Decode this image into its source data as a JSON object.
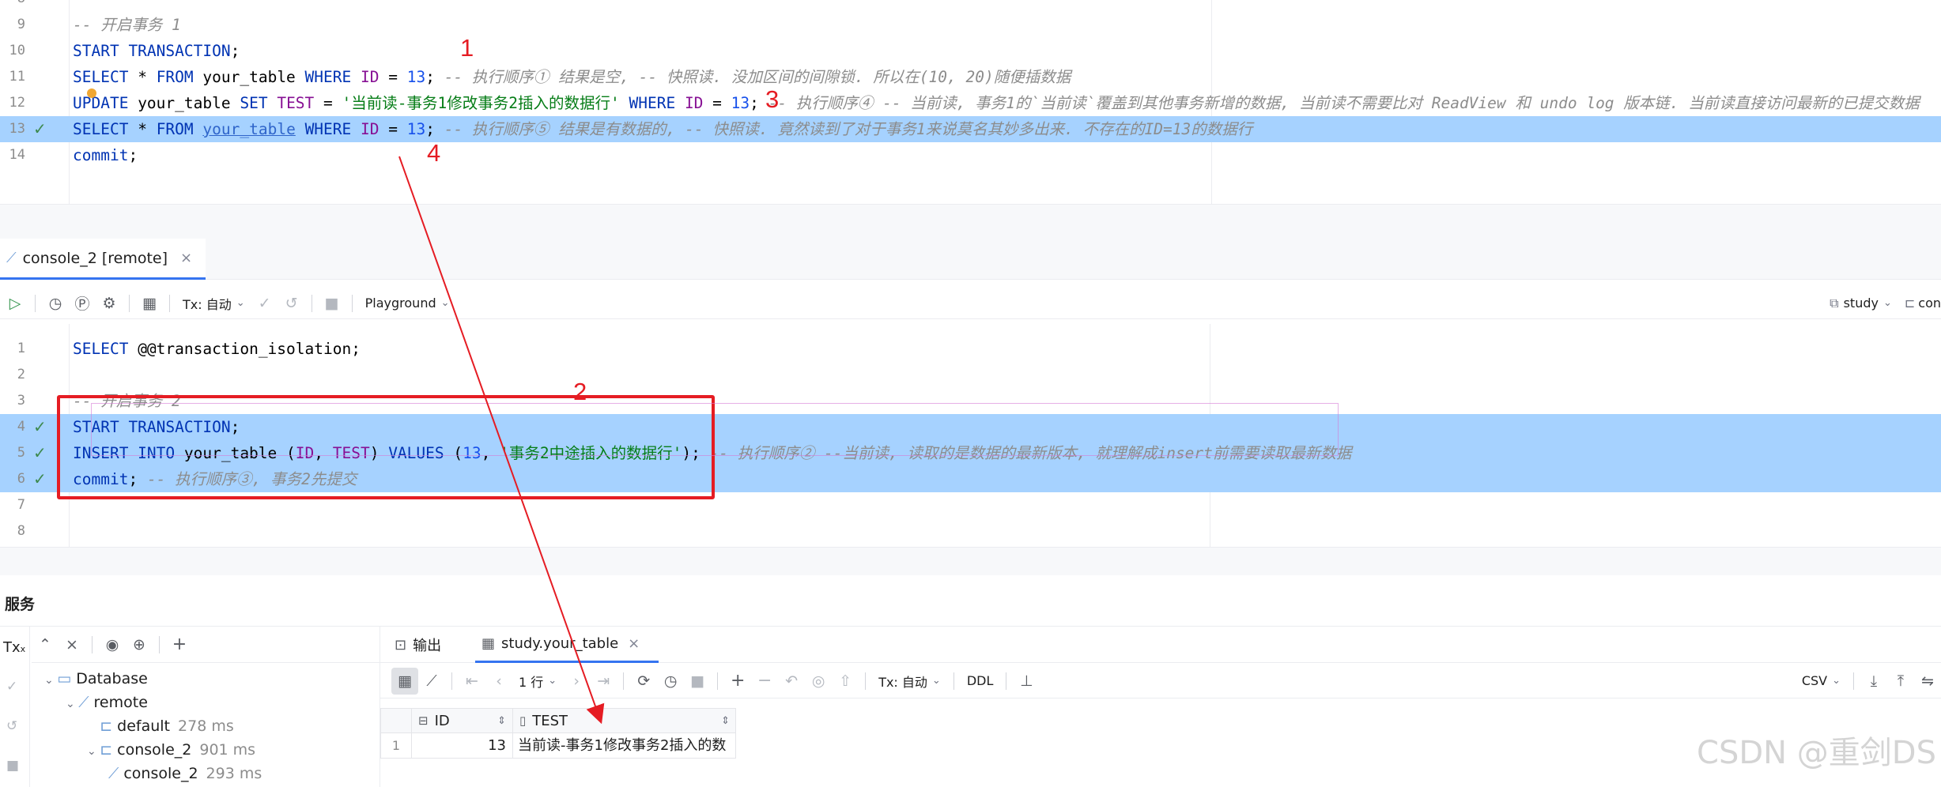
{
  "editor_top": {
    "lines": [
      {
        "n": "8",
        "tokens": []
      },
      {
        "n": "9",
        "tokens": [
          {
            "c": "cm",
            "t": "-- 开启事务 1"
          }
        ]
      },
      {
        "n": "10",
        "tokens": [
          {
            "c": "kw",
            "t": "START TRANSACTION"
          },
          {
            "c": "pl",
            "t": ";"
          }
        ]
      },
      {
        "n": "11",
        "tokens": [
          {
            "c": "kw",
            "t": "SELECT"
          },
          {
            "c": "pl",
            "t": " * "
          },
          {
            "c": "kw",
            "t": "FROM"
          },
          {
            "c": "pl",
            "t": " your_table "
          },
          {
            "c": "kw",
            "t": "WHERE"
          },
          {
            "c": "pl",
            "t": " "
          },
          {
            "c": "id",
            "t": "ID"
          },
          {
            "c": "pl",
            "t": " = "
          },
          {
            "c": "num",
            "t": "13"
          },
          {
            "c": "pl",
            "t": "; "
          },
          {
            "c": "cm",
            "t": "-- 执行顺序① 结果是空, -- 快照读. 没加区间的间隙锁. 所以在(10, 20)随便插数据"
          }
        ]
      },
      {
        "n": "12",
        "tokens": [
          {
            "c": "kw",
            "t": "UPDATE"
          },
          {
            "c": "pl",
            "t": " your_table "
          },
          {
            "c": "kw",
            "t": "SET"
          },
          {
            "c": "pl",
            "t": " "
          },
          {
            "c": "id",
            "t": "TEST"
          },
          {
            "c": "pl",
            "t": " = "
          },
          {
            "c": "str",
            "t": "'当前读-事务1修改事务2插入的数据行'"
          },
          {
            "c": "pl",
            "t": " "
          },
          {
            "c": "kw",
            "t": "WHERE"
          },
          {
            "c": "pl",
            "t": " "
          },
          {
            "c": "id",
            "t": "ID"
          },
          {
            "c": "pl",
            "t": " = "
          },
          {
            "c": "num",
            "t": "13"
          },
          {
            "c": "pl",
            "t": "; "
          },
          {
            "c": "cm",
            "t": "-- 执行顺序④ -- 当前读, 事务1的`当前读`覆盖到其他事务新增的数据, 当前读不需要比对 ReadView 和 undo log 版本链. 当前读直接访问最新的已提交数据"
          }
        ]
      },
      {
        "n": "13",
        "hl": true,
        "check": true,
        "tokens": [
          {
            "c": "kw",
            "t": "SELECT"
          },
          {
            "c": "pl",
            "t": " * "
          },
          {
            "c": "kw",
            "t": "FROM"
          },
          {
            "c": "pl",
            "t": " "
          },
          {
            "c": "ul",
            "t": "your_table"
          },
          {
            "c": "pl",
            "t": " "
          },
          {
            "c": "kw",
            "t": "WHERE"
          },
          {
            "c": "pl",
            "t": " "
          },
          {
            "c": "id",
            "t": "ID"
          },
          {
            "c": "pl",
            "t": " = "
          },
          {
            "c": "num",
            "t": "13"
          },
          {
            "c": "pl",
            "t": "; "
          },
          {
            "c": "cm",
            "t": "-- 执行顺序⑤ 结果是有数据的, -- 快照读. 竟然读到了对于事务1来说莫名其妙多出来. 不存在的ID=13的数据行"
          }
        ]
      },
      {
        "n": "14",
        "tokens": [
          {
            "c": "kw",
            "t": "commit"
          },
          {
            "c": "pl",
            "t": ";"
          }
        ]
      }
    ]
  },
  "console_tab": {
    "label": "console_2 [remote]"
  },
  "console_toolbar": {
    "tx_label": "Tx: 自动",
    "playground_label": "Playground",
    "schema_label": "study",
    "conn_label": "con"
  },
  "editor_bottom": {
    "lines": [
      {
        "n": "1",
        "tokens": [
          {
            "c": "kw",
            "t": "SELECT"
          },
          {
            "c": "pl",
            "t": " @@transaction_isolation;"
          }
        ]
      },
      {
        "n": "2",
        "tokens": []
      },
      {
        "n": "3",
        "tokens": [
          {
            "c": "cm",
            "t": "-- 开启事务 2"
          }
        ]
      },
      {
        "n": "4",
        "hl": true,
        "check": true,
        "tokens": [
          {
            "c": "kw",
            "t": "START TRANSACTION"
          },
          {
            "c": "pl",
            "t": ";"
          }
        ]
      },
      {
        "n": "5",
        "hl": true,
        "check": true,
        "tokens": [
          {
            "c": "kw",
            "t": "INSERT INTO"
          },
          {
            "c": "pl",
            "t": " your_table ("
          },
          {
            "c": "id",
            "t": "ID"
          },
          {
            "c": "pl",
            "t": ", "
          },
          {
            "c": "id",
            "t": "TEST"
          },
          {
            "c": "pl",
            "t": ") "
          },
          {
            "c": "kw",
            "t": "VALUES"
          },
          {
            "c": "pl",
            "t": " ("
          },
          {
            "c": "num",
            "t": "13"
          },
          {
            "c": "pl",
            "t": ", "
          },
          {
            "c": "str",
            "t": "'事务2中途插入的数据行'"
          },
          {
            "c": "pl",
            "t": "); "
          },
          {
            "c": "cm",
            "t": "-- 执行顺序② --当前读, 读取的是数据的最新版本, 就理解成insert前需要读取最新数据"
          }
        ]
      },
      {
        "n": "6",
        "hl": true,
        "check": true,
        "tokens": [
          {
            "c": "kw",
            "t": "commit"
          },
          {
            "c": "pl",
            "t": "; "
          },
          {
            "c": "cm",
            "t": "-- 执行顺序③, 事务2先提交"
          }
        ]
      },
      {
        "n": "7",
        "tokens": []
      },
      {
        "n": "8",
        "tokens": []
      }
    ]
  },
  "annotations": {
    "a1": "1",
    "a2": "2",
    "a3": "3",
    "a4": "4"
  },
  "services": {
    "title": "服务",
    "tx_icon_text": "Tx",
    "tree": [
      {
        "label": "Database",
        "time": "",
        "depth": 0,
        "icon": "folder"
      },
      {
        "label": "remote",
        "time": "",
        "depth": 1,
        "icon": "db"
      },
      {
        "label": "default",
        "time": "278 ms",
        "depth": 2,
        "icon": "session"
      },
      {
        "label": "console_2",
        "time": "901 ms",
        "depth": 2,
        "icon": "session"
      },
      {
        "label": "console_2",
        "time": "293 ms",
        "depth": 3,
        "icon": "console"
      }
    ]
  },
  "result_tabs": {
    "output_label": "输出",
    "table_label": "study.your_table"
  },
  "result_toolbar": {
    "rows_label": "1 行",
    "tx_label": "Tx: 自动",
    "ddl_label": "DDL",
    "csv_label": "CSV"
  },
  "grid": {
    "columns": [
      "ID",
      "TEST"
    ],
    "rows": [
      {
        "rownum": "1",
        "id": "13",
        "test": "当前读-事务1修改事务2插入的数"
      }
    ]
  },
  "watermark": "CSDN @重剑DS"
}
